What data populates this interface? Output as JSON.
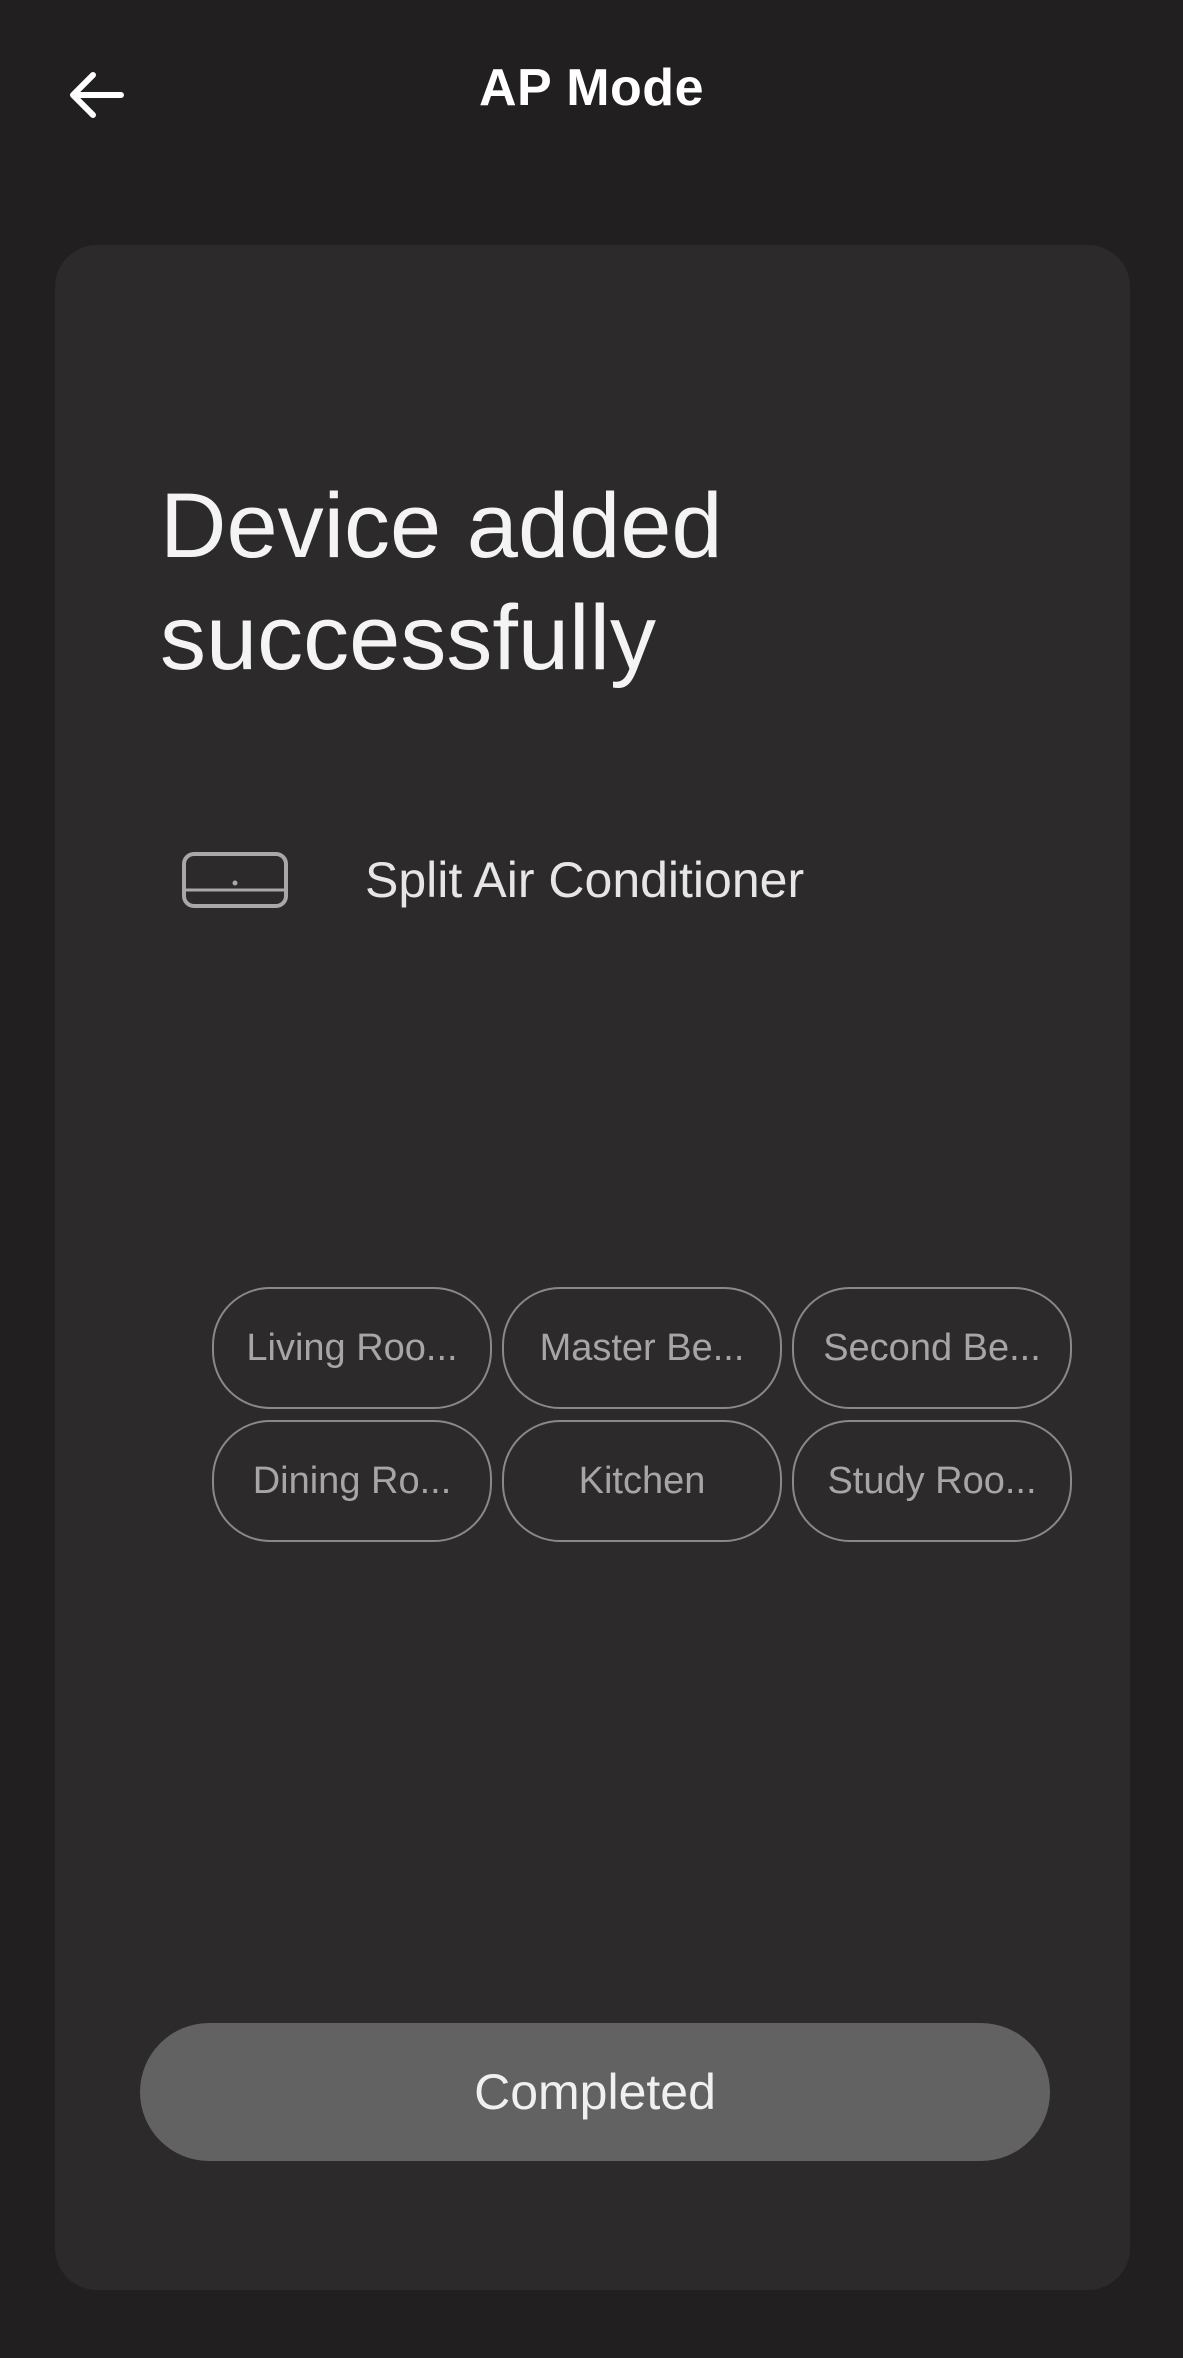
{
  "header": {
    "title": "AP Mode",
    "back_icon": "arrow-left-icon"
  },
  "result": {
    "headline": "Device added successfully"
  },
  "device": {
    "icon": "split-air-conditioner-icon",
    "name": "Split Air Conditioner"
  },
  "rooms": [
    {
      "label": "Living Roo..."
    },
    {
      "label": "Master Be..."
    },
    {
      "label": "Second Be..."
    },
    {
      "label": "Dining Ro..."
    },
    {
      "label": "Kitchen"
    },
    {
      "label": "Study Roo..."
    }
  ],
  "footer": {
    "completed_label": "Completed"
  },
  "colors": {
    "background": "#221f20",
    "card": "#2c2a2b",
    "button": "#636263"
  }
}
